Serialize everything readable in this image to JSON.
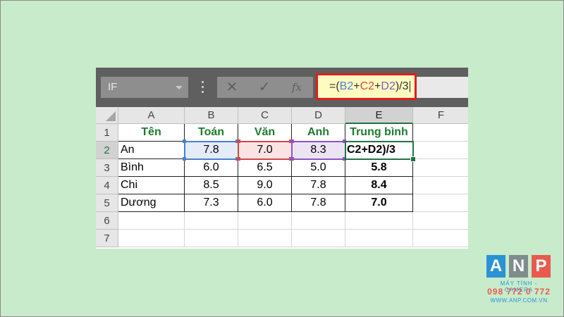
{
  "formula_bar": {
    "name_box": "IF",
    "cancel_icon": "✕",
    "enter_icon": "✓",
    "fx_label": "fx",
    "formula_parts": [
      "=(",
      "B2",
      "+",
      "C2",
      "+",
      "D2",
      ")/3"
    ]
  },
  "sheet": {
    "columns": [
      "A",
      "B",
      "C",
      "D",
      "E",
      "F"
    ],
    "rows": [
      "1",
      "2",
      "3",
      "4",
      "5",
      "6",
      "7"
    ],
    "header_row": [
      "Tên",
      "Toán",
      "Văn",
      "Anh",
      "Trung bình"
    ],
    "data_rows": [
      [
        "An",
        "7.8",
        "7.0",
        "8.3",
        "C2+D2)/3"
      ],
      [
        "Bình",
        "6.0",
        "6.5",
        "5.0",
        "5.8"
      ],
      [
        "Chi",
        "8.5",
        "9.0",
        "7.8",
        "8.4"
      ],
      [
        "Dương",
        "7.3",
        "6.0",
        "7.8",
        "7.0"
      ]
    ],
    "active_cell": "E2"
  },
  "colors": {
    "formula_highlight_border": "#e11d1d",
    "ref_b2": "#4a7fd1",
    "ref_c2": "#d04848",
    "ref_d2": "#8a55c7",
    "header_text": "#1e7b2e",
    "excel_green": "#217346"
  },
  "logo": {
    "letters": [
      "A",
      "N",
      "P"
    ],
    "subtitle": "MÁY TÍNH - CAMERA",
    "phone": "098 772 0 772",
    "website": "WWW.ANP.COM.VN"
  }
}
